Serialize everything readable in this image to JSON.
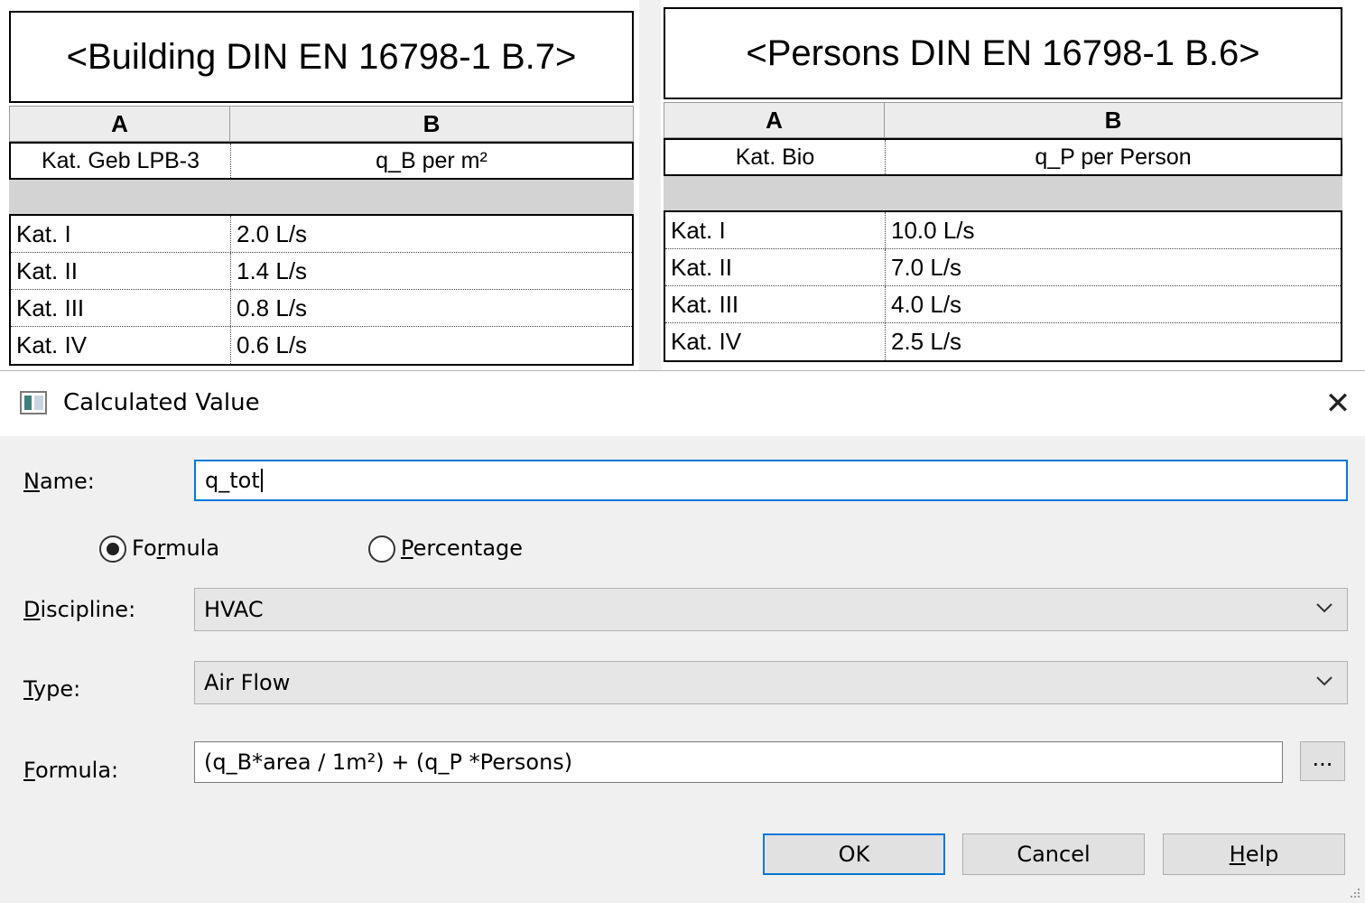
{
  "schedule_building": {
    "title": "<Building DIN EN 16798-1 B.7>",
    "col_a": "A",
    "col_b": "B",
    "header_a": "Kat. Geb LPB-3",
    "header_b": "q_B per m²",
    "rows": [
      {
        "cat": "Kat. I",
        "value": "2.0 L/s"
      },
      {
        "cat": "Kat. II",
        "value": "1.4 L/s"
      },
      {
        "cat": "Kat. III",
        "value": "0.8 L/s"
      },
      {
        "cat": "Kat. IV",
        "value": "0.6 L/s"
      }
    ]
  },
  "schedule_persons": {
    "title": "<Persons DIN EN 16798-1 B.6>",
    "col_a": "A",
    "col_b": "B",
    "header_a": "Kat. Bio",
    "header_b": "q_P per Person",
    "rows": [
      {
        "cat": "Kat. I",
        "value": "10.0 L/s"
      },
      {
        "cat": "Kat. II",
        "value": "7.0 L/s"
      },
      {
        "cat": "Kat. III",
        "value": "4.0 L/s"
      },
      {
        "cat": "Kat. IV",
        "value": "2.5 L/s"
      }
    ]
  },
  "dialog": {
    "title": "Calculated Value",
    "close_symbol": "✕",
    "name_label_u": "N",
    "name_label_rest": "ame:",
    "name_value": "q_tot",
    "radio_formula_pre": "Fo",
    "radio_formula_u": "r",
    "radio_formula_post": "mula",
    "radio_formula_selected": true,
    "radio_percentage_u": "P",
    "radio_percentage_rest": "ercentage",
    "discipline_label_u": "D",
    "discipline_label_rest": "iscipline:",
    "discipline_value": "HVAC",
    "type_label_u": "T",
    "type_label_rest": "ype:",
    "type_value": "Air Flow",
    "formula_label_u": "F",
    "formula_label_rest": "ormula:",
    "formula_value": "(q_B*area / 1m²) + (q_P *Persons)",
    "ellipsis_label": "...",
    "ok_label": "OK",
    "cancel_label": "Cancel",
    "help_label_u": "H",
    "help_label_rest": "elp",
    "accent_color": "#0078d7"
  }
}
